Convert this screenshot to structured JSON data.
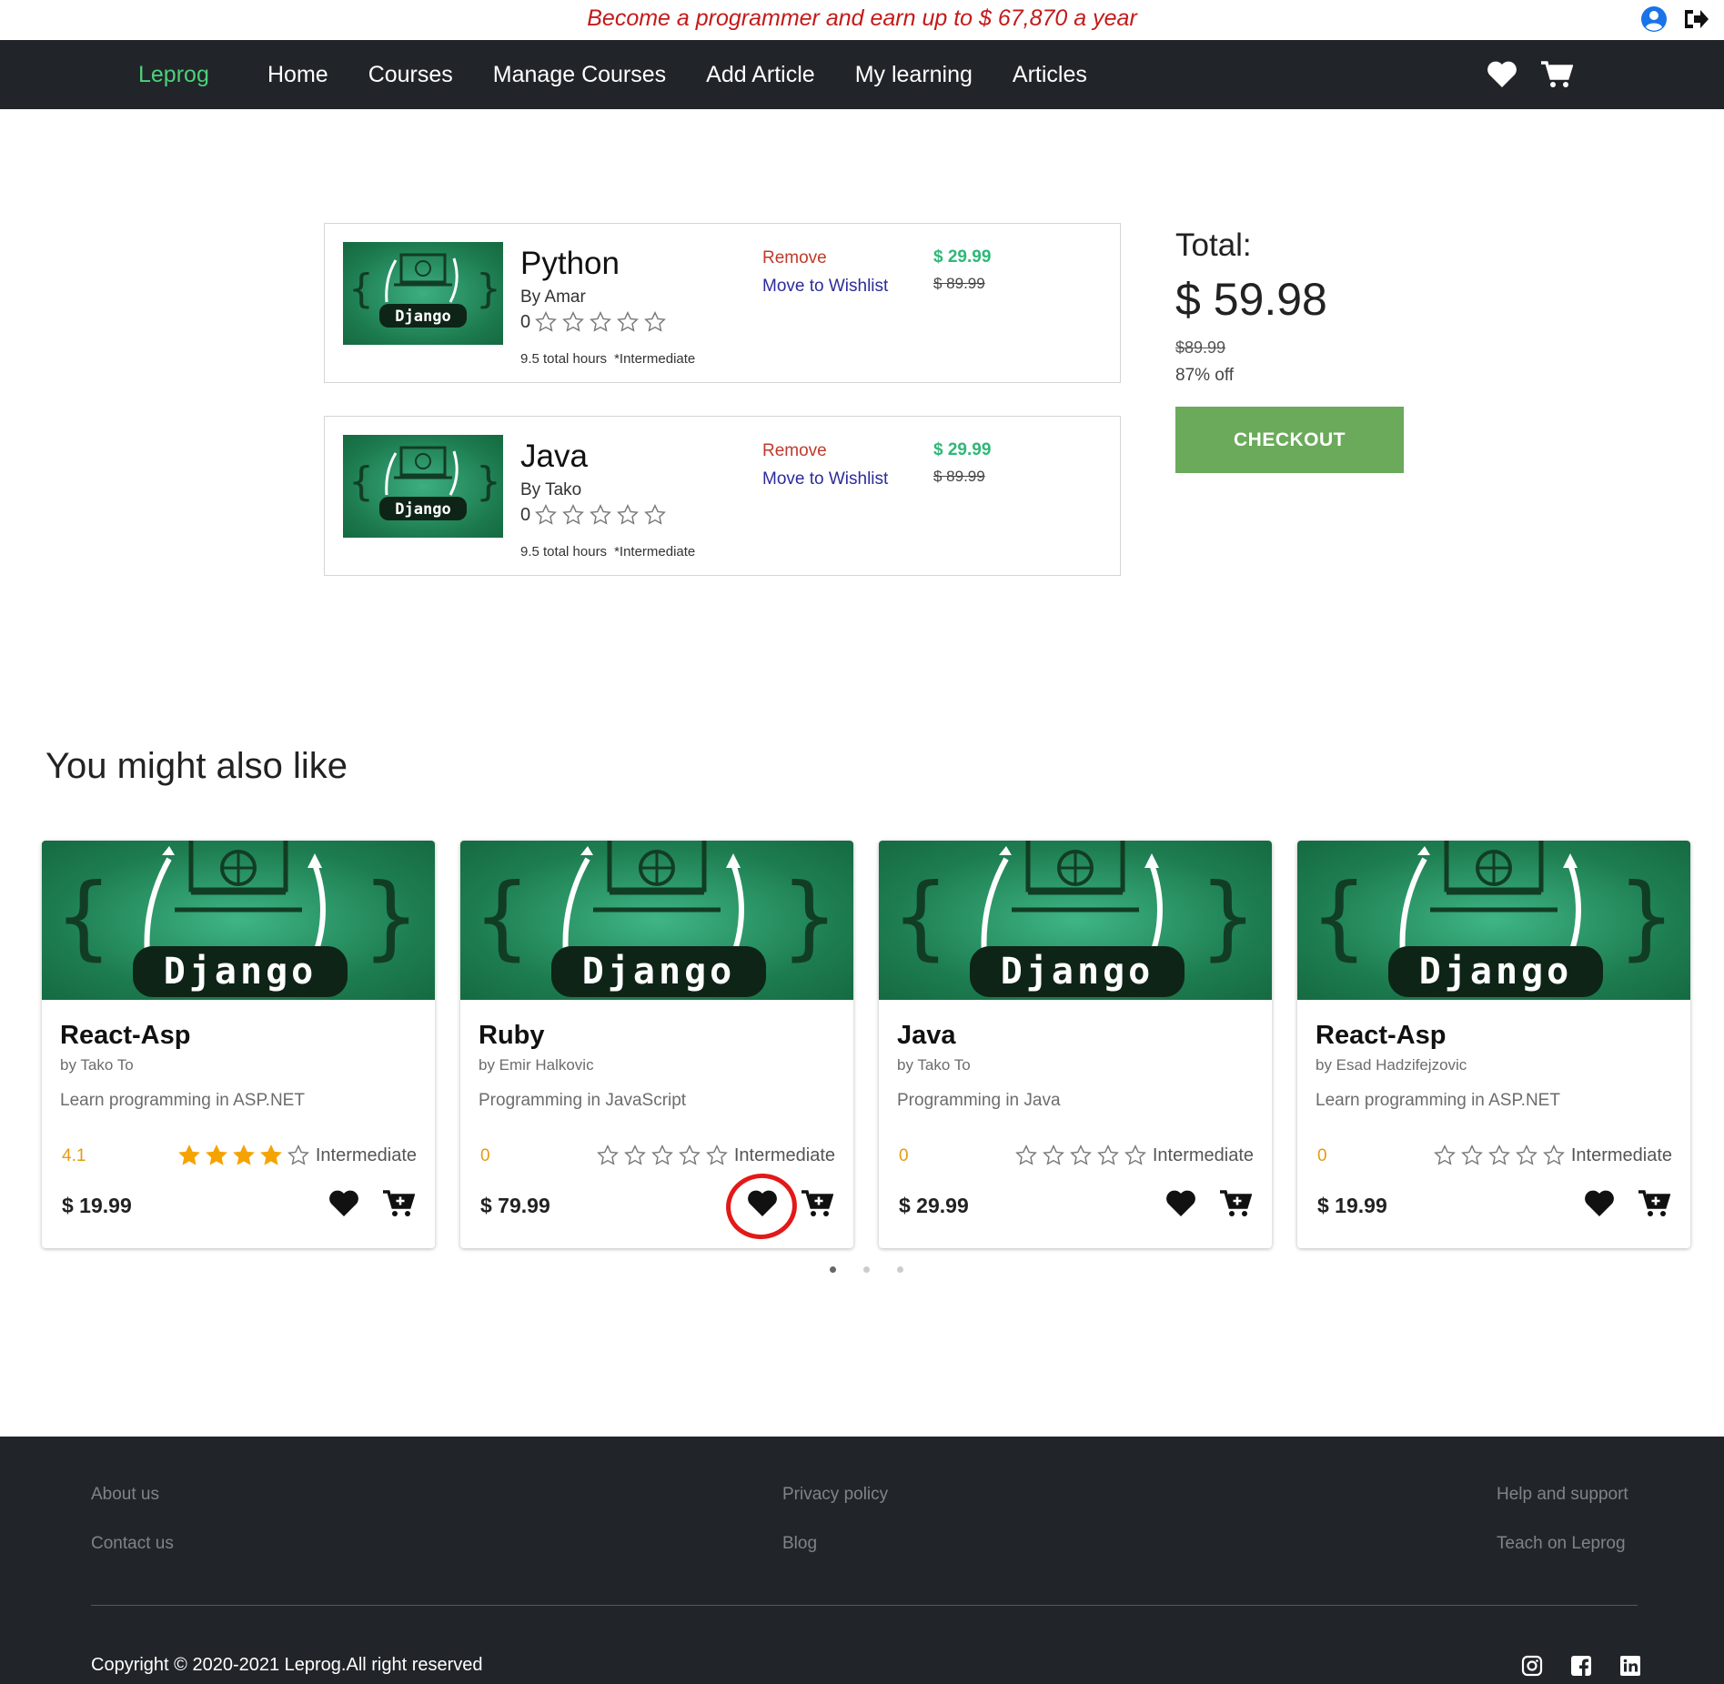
{
  "promo": {
    "text": "Become a programmer and earn up to $ 67,870 a year"
  },
  "icons": {
    "user": "user-circle-icon",
    "logout": "sign-out-icon",
    "wishlist": "heart-icon",
    "cart": "shopping-cart-icon"
  },
  "nav": {
    "brand": "Leprog",
    "links": [
      "Home",
      "Courses",
      "Manage Courses",
      "Add Article",
      "My learning",
      "Articles"
    ]
  },
  "cart": {
    "items": [
      {
        "title": "Python",
        "author": "By Amar",
        "rating": "0",
        "hours": "9.5 total hours",
        "level": "*Intermediate",
        "remove": "Remove",
        "move": "Move to Wishlist",
        "price": "$ 29.99",
        "old_price": "$ 89.99",
        "thumb_label": "Django"
      },
      {
        "title": "Java",
        "author": "By Tako",
        "rating": "0",
        "hours": "9.5 total hours",
        "level": "*Intermediate",
        "remove": "Remove",
        "move": "Move to Wishlist",
        "price": "$ 29.99",
        "old_price": "$ 89.99",
        "thumb_label": "Django"
      }
    ]
  },
  "summary": {
    "label": "Total:",
    "total": "$ 59.98",
    "old_total": "$89.99",
    "discount": "87% off",
    "checkout": "CHECKOUT"
  },
  "recommend": {
    "title": "You might also like",
    "cards": [
      {
        "title": "React-Asp",
        "author": "by Tako To",
        "desc": "Learn programming in ASP.NET",
        "rating": "4.1",
        "filled_stars": 4,
        "level": "Intermediate",
        "price": "$ 19.99",
        "img_label": "Django"
      },
      {
        "title": "Ruby",
        "author": "by Emir Halkovic",
        "desc": "Programming in JavaScript",
        "rating": "0",
        "filled_stars": 0,
        "level": "Intermediate",
        "price": "$ 79.99",
        "img_label": "Django"
      },
      {
        "title": "Java",
        "author": "by Tako To",
        "desc": "Programming in Java",
        "rating": "0",
        "filled_stars": 0,
        "level": "Intermediate",
        "price": "$ 29.99",
        "img_label": "Django"
      },
      {
        "title": "React-Asp",
        "author": "by Esad Hadzifejzovic",
        "desc": "Learn programming in ASP.NET",
        "rating": "0",
        "filled_stars": 0,
        "level": "Intermediate",
        "price": "$ 19.99",
        "img_label": "Django"
      }
    ],
    "page_count": 3,
    "active_page": 1,
    "highlight_color": "#e41818"
  },
  "footer": {
    "links": {
      "about": "About us",
      "contact": "Contact us",
      "privacy": "Privacy policy",
      "blog": "Blog",
      "help": "Help and support",
      "teach": "Teach on Leprog"
    },
    "copyright": "Copyright © 2020-2021 Leprog.All right reserved",
    "social": [
      "instagram-icon",
      "facebook-icon",
      "linkedin-icon"
    ]
  },
  "colors": {
    "brand": "#4cd17a",
    "navbar": "#212529",
    "promo": "#c41a1a",
    "price_green": "#2eb877",
    "checkout": "#6aaa5a",
    "star": "#f5a300"
  }
}
